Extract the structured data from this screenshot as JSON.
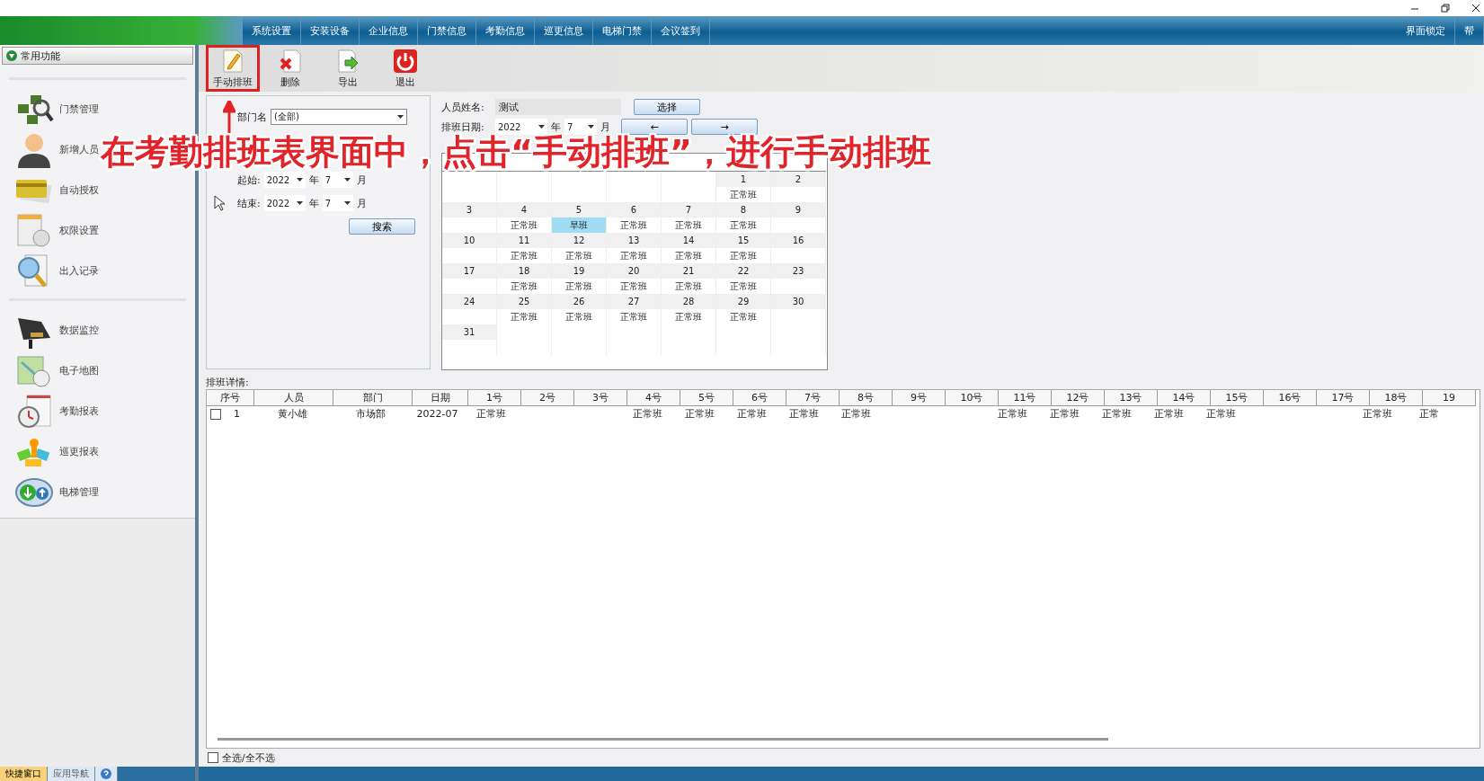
{
  "menu": {
    "items": [
      {
        "label": "系统设置"
      },
      {
        "label": "安装设备"
      },
      {
        "label": "企业信息"
      },
      {
        "label": "门禁信息"
      },
      {
        "label": "考勤信息"
      },
      {
        "label": "巡更信息"
      },
      {
        "label": "电梯门禁"
      },
      {
        "label": "会议签到"
      }
    ],
    "right_items": [
      {
        "label": "界面锁定"
      },
      {
        "label": "帮"
      }
    ]
  },
  "sidebar": {
    "title": "常用功能",
    "expanded": true,
    "groups": [
      [
        {
          "label": "门禁管理",
          "kind": "chips"
        },
        {
          "label": "新增人员",
          "kind": "person"
        },
        {
          "label": "自动授权",
          "kind": "card"
        },
        {
          "label": "权限设置",
          "kind": "doc"
        },
        {
          "label": "出入记录",
          "kind": "magnifier"
        }
      ],
      [
        {
          "label": "数据监控",
          "kind": "camera"
        },
        {
          "label": "电子地图",
          "kind": "map"
        },
        {
          "label": "考勤报表",
          "kind": "clock"
        },
        {
          "label": "巡更报表",
          "kind": "puzzle"
        },
        {
          "label": "电梯管理",
          "kind": "arrows"
        }
      ]
    ],
    "tabs": [
      {
        "label": "快捷窗口",
        "selected": true
      },
      {
        "label": "应用导航",
        "selected": false
      }
    ]
  },
  "toolbar": [
    {
      "label": "手动排班",
      "kind": "edit",
      "highlighted": true
    },
    {
      "label": "删除",
      "kind": "delete",
      "highlighted": false
    },
    {
      "label": "导出",
      "kind": "export",
      "highlighted": false
    },
    {
      "label": "退出",
      "kind": "exit",
      "highlighted": false
    }
  ],
  "filter": {
    "department_label": "部门名",
    "department_value": "(全部)",
    "start_label": "起始:",
    "start_year": "2022",
    "start_year_unit": "年",
    "start_month": "7",
    "start_month_unit": "月",
    "end_label": "结束:",
    "end_year": "2022",
    "end_year_unit": "年",
    "end_month": "7",
    "end_month_unit": "月",
    "search_button": "搜索"
  },
  "schedule": {
    "person_label": "人员姓名:",
    "person_value": "测试",
    "select_button": "选择",
    "date_label": "排班日期:",
    "year": "2022",
    "year_unit": "年",
    "month": "7",
    "month_unit": "月",
    "prev_button": "←",
    "next_button": "→"
  },
  "calendar": {
    "weeks": [
      [
        {
          "kind": "blank"
        },
        {
          "kind": "blank"
        },
        {
          "kind": "blank"
        },
        {
          "kind": "blank"
        },
        {
          "kind": "blank"
        },
        {
          "day": "1",
          "shift": "正常班",
          "selected": false
        },
        {
          "day": "2"
        }
      ],
      [
        {
          "day": "3"
        },
        {
          "day": "4",
          "shift": "正常班",
          "selected": false
        },
        {
          "day": "5",
          "shift": "早班",
          "selected": true
        },
        {
          "day": "6",
          "shift": "正常班",
          "selected": false
        },
        {
          "day": "7",
          "shift": "正常班",
          "selected": false
        },
        {
          "day": "8",
          "shift": "正常班",
          "selected": false
        },
        {
          "day": "9"
        }
      ],
      [
        {
          "day": "10"
        },
        {
          "day": "11",
          "shift": "正常班",
          "selected": false
        },
        {
          "day": "12",
          "shift": "正常班",
          "selected": false
        },
        {
          "day": "13",
          "shift": "正常班",
          "selected": false
        },
        {
          "day": "14",
          "shift": "正常班",
          "selected": false
        },
        {
          "day": "15",
          "shift": "正常班",
          "selected": false
        },
        {
          "day": "16"
        }
      ],
      [
        {
          "day": "17"
        },
        {
          "day": "18",
          "shift": "正常班",
          "selected": false
        },
        {
          "day": "19",
          "shift": "正常班",
          "selected": false
        },
        {
          "day": "20",
          "shift": "正常班",
          "selected": false
        },
        {
          "day": "21",
          "shift": "正常班",
          "selected": false
        },
        {
          "day": "22",
          "shift": "正常班",
          "selected": false
        },
        {
          "day": "23"
        }
      ],
      [
        {
          "day": "24"
        },
        {
          "day": "25",
          "shift": "正常班",
          "selected": false
        },
        {
          "day": "26",
          "shift": "正常班",
          "selected": false
        },
        {
          "day": "27",
          "shift": "正常班",
          "selected": false
        },
        {
          "day": "28",
          "shift": "正常班",
          "selected": false
        },
        {
          "day": "29",
          "shift": "正常班",
          "selected": false
        },
        {
          "day": "30"
        }
      ],
      [
        {
          "day": "31"
        },
        {
          "kind": "blank"
        },
        {
          "kind": "blank"
        },
        {
          "kind": "blank"
        },
        {
          "kind": "blank"
        },
        {
          "kind": "blank"
        },
        {
          "kind": "blank"
        }
      ]
    ]
  },
  "table": {
    "title": "排班详情:",
    "columns": [
      "序号",
      "人员",
      "部门",
      "日期",
      "1号",
      "2号",
      "3号",
      "4号",
      "5号",
      "6号",
      "7号",
      "8号",
      "9号",
      "10号",
      "11号",
      "12号",
      "13号",
      "14号",
      "15号",
      "16号",
      "17号",
      "18号",
      "19"
    ],
    "rows": [
      {
        "checked": false,
        "cells": [
          "1",
          "黄小雄",
          "市场部",
          "2022-07",
          "正常班",
          null,
          null,
          "正常班",
          "正常班",
          "正常班",
          "正常班",
          "正常班",
          null,
          null,
          "正常班",
          "正常班",
          "正常班",
          "正常班",
          "正常班",
          null,
          null,
          "正常班",
          "正常"
        ]
      }
    ],
    "select_all": {
      "label": "全选/全不选",
      "checked": false
    }
  },
  "annotation": {
    "text": "在考勤排班表界面中，点击“手动排班”，进行手动排班"
  }
}
